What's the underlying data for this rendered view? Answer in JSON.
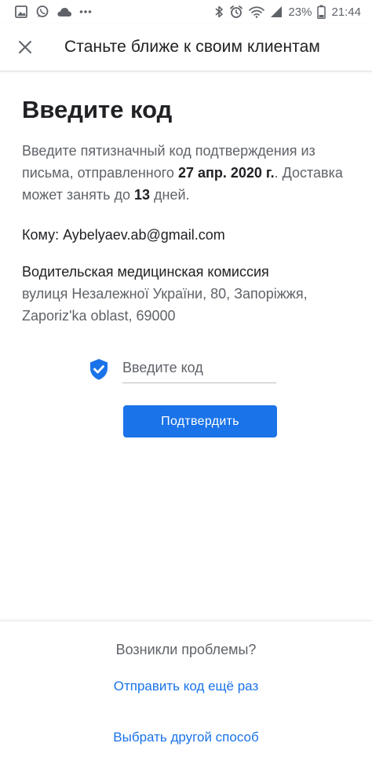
{
  "status_bar": {
    "battery": "23%",
    "time": "21:44"
  },
  "app_bar": {
    "title": "Станьте ближе к своим клиентам"
  },
  "main": {
    "heading": "Введите код",
    "info_part1": "Введите пятизначный код подтверждения из письма, отправленного ",
    "sent_date": "27 апр. 2020 г.",
    "info_part2": ". Доставка может занять до ",
    "delivery_days": "13",
    "info_part3": " дней.",
    "recipient": "Кому: Aybelyaev.ab@gmail.com",
    "org_name": "Водительская медицинская комиссия",
    "address_line1": "вулиця Незалежної України, 80, Запоріжжя,",
    "address_line2": "Zaporiz'ka oblast, 69000",
    "code_placeholder": "Введите код",
    "confirm_label": "Подтвердить"
  },
  "footer": {
    "question": "Возникли проблемы?",
    "resend_label": "Отправить код ещё раз",
    "other_method_label": "Выбрать другой способ"
  },
  "colors": {
    "accent": "#1a73e8",
    "secondary_text": "#5f6368",
    "primary_text": "#202124"
  }
}
